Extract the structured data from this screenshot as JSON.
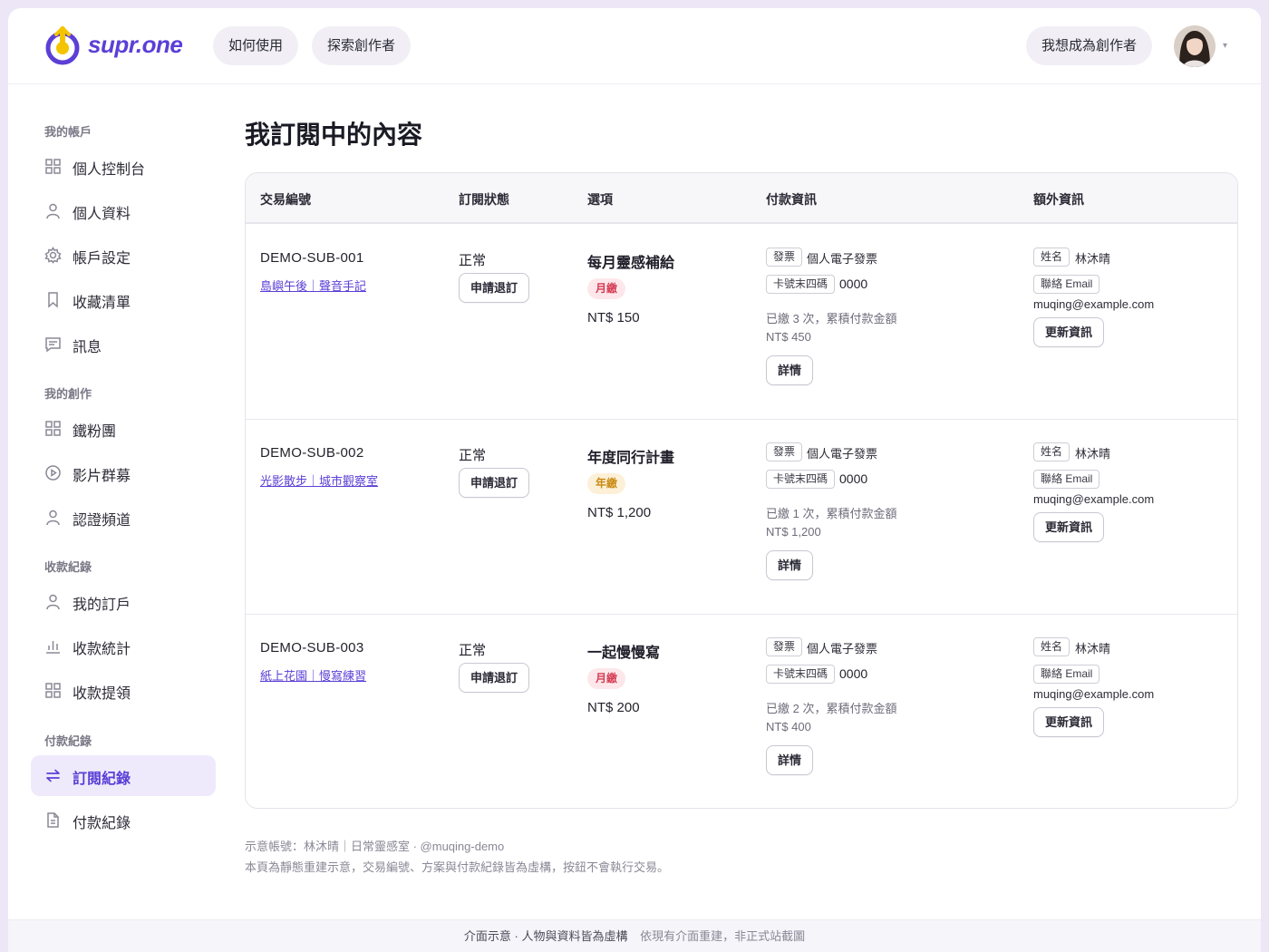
{
  "brand": {
    "name": "supr.one",
    "accent": "#5b3fd6"
  },
  "header": {
    "nav": [
      "如何使用",
      "探索創作者"
    ],
    "cta": "我想成為創作者",
    "avatar_caret": "▾"
  },
  "sidebar": {
    "sections": [
      {
        "title": "我的帳戶",
        "items": [
          {
            "label": "個人控制台",
            "icon": "grid-icon"
          },
          {
            "label": "個人資料",
            "icon": "user-icon"
          },
          {
            "label": "帳戶設定",
            "icon": "gear-icon"
          },
          {
            "label": "收藏清單",
            "icon": "bookmark-icon"
          },
          {
            "label": "訊息",
            "icon": "message-icon"
          }
        ]
      },
      {
        "title": "我的創作",
        "items": [
          {
            "label": "鐵粉團",
            "icon": "grid-icon"
          },
          {
            "label": "影片群募",
            "icon": "play-icon"
          },
          {
            "label": "認證頻道",
            "icon": "user-icon"
          }
        ]
      },
      {
        "title": "收款紀錄",
        "items": [
          {
            "label": "我的訂戶",
            "icon": "user-icon"
          },
          {
            "label": "收款統計",
            "icon": "bar-chart-icon"
          },
          {
            "label": "收款提領",
            "icon": "grid-icon"
          }
        ]
      },
      {
        "title": "付款紀錄",
        "items": [
          {
            "label": "訂閱紀錄",
            "icon": "swap-icon",
            "active": true
          },
          {
            "label": "付款紀錄",
            "icon": "document-icon"
          }
        ]
      }
    ]
  },
  "main": {
    "title": "我訂閱中的內容",
    "columns": [
      "交易編號",
      "訂閱狀態",
      "選項",
      "付款資訊",
      "額外資訊"
    ],
    "rows": [
      {
        "id": "DEMO-SUB-001",
        "creator": "島嶼午後｜聲音手記",
        "status": "正常",
        "cancel": "申請退訂",
        "plan": "每月靈感補給",
        "cycle": "月繳",
        "cycle_type": "monthly",
        "price": "NT$ 150",
        "invoice_tag": "發票",
        "invoice": "個人電子發票",
        "card_tag": "卡號末四碼",
        "card": "0000",
        "paid_summary": "已繳 3 次，累積付款金額",
        "paid_total": "NT$ 450",
        "detail": "詳情",
        "name_tag": "姓名",
        "name": "林沐晴",
        "email_tag": "聯絡 Email",
        "email": "muqing@example.com",
        "update": "更新資訊"
      },
      {
        "id": "DEMO-SUB-002",
        "creator": "光影散步｜城市觀察室",
        "status": "正常",
        "cancel": "申請退訂",
        "plan": "年度同行計畫",
        "cycle": "年繳",
        "cycle_type": "yearly",
        "price": "NT$ 1,200",
        "invoice_tag": "發票",
        "invoice": "個人電子發票",
        "card_tag": "卡號末四碼",
        "card": "0000",
        "paid_summary": "已繳 1 次，累積付款金額",
        "paid_total": "NT$ 1,200",
        "detail": "詳情",
        "name_tag": "姓名",
        "name": "林沐晴",
        "email_tag": "聯絡 Email",
        "email": "muqing@example.com",
        "update": "更新資訊"
      },
      {
        "id": "DEMO-SUB-003",
        "creator": "紙上花園｜慢寫練習",
        "status": "正常",
        "cancel": "申請退訂",
        "plan": "一起慢慢寫",
        "cycle": "月繳",
        "cycle_type": "monthly",
        "price": "NT$ 200",
        "invoice_tag": "發票",
        "invoice": "個人電子發票",
        "card_tag": "卡號末四碼",
        "card": "0000",
        "paid_summary": "已繳 2 次，累積付款金額",
        "paid_total": "NT$ 400",
        "detail": "詳情",
        "name_tag": "姓名",
        "name": "林沐晴",
        "email_tag": "聯絡 Email",
        "email": "muqing@example.com",
        "update": "更新資訊"
      }
    ],
    "footnotes": [
      "示意帳號：林沐晴｜日常靈感室 · @muqing-demo",
      "本頁為靜態重建示意，交易編號、方案與付款紀錄皆為虛構，按鈕不會執行交易。"
    ]
  },
  "footer": {
    "primary": "介面示意 · 人物與資料皆為虛構",
    "secondary": "依現有介面重建，非正式站截圖"
  }
}
